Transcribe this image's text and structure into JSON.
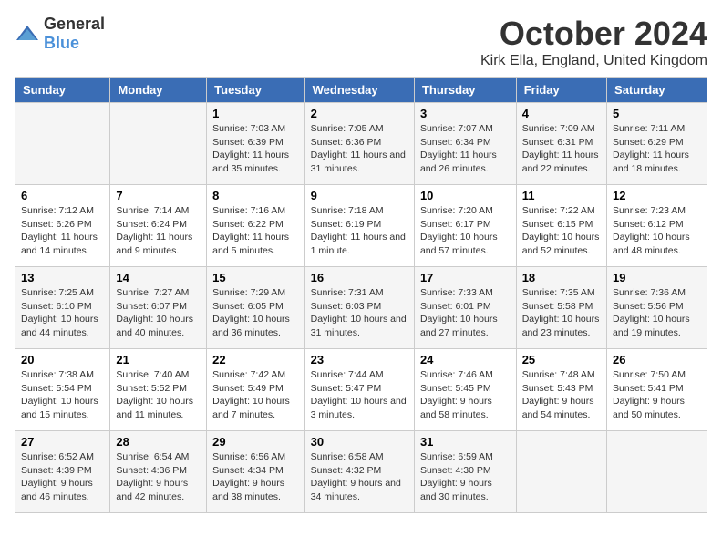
{
  "logo": {
    "general": "General",
    "blue": "Blue"
  },
  "title": "October 2024",
  "location": "Kirk Ella, England, United Kingdom",
  "days_header": [
    "Sunday",
    "Monday",
    "Tuesday",
    "Wednesday",
    "Thursday",
    "Friday",
    "Saturday"
  ],
  "weeks": [
    [
      {
        "day": "",
        "sunrise": "",
        "sunset": "",
        "daylight": ""
      },
      {
        "day": "",
        "sunrise": "",
        "sunset": "",
        "daylight": ""
      },
      {
        "day": "1",
        "sunrise": "Sunrise: 7:03 AM",
        "sunset": "Sunset: 6:39 PM",
        "daylight": "Daylight: 11 hours and 35 minutes."
      },
      {
        "day": "2",
        "sunrise": "Sunrise: 7:05 AM",
        "sunset": "Sunset: 6:36 PM",
        "daylight": "Daylight: 11 hours and 31 minutes."
      },
      {
        "day": "3",
        "sunrise": "Sunrise: 7:07 AM",
        "sunset": "Sunset: 6:34 PM",
        "daylight": "Daylight: 11 hours and 26 minutes."
      },
      {
        "day": "4",
        "sunrise": "Sunrise: 7:09 AM",
        "sunset": "Sunset: 6:31 PM",
        "daylight": "Daylight: 11 hours and 22 minutes."
      },
      {
        "day": "5",
        "sunrise": "Sunrise: 7:11 AM",
        "sunset": "Sunset: 6:29 PM",
        "daylight": "Daylight: 11 hours and 18 minutes."
      }
    ],
    [
      {
        "day": "6",
        "sunrise": "Sunrise: 7:12 AM",
        "sunset": "Sunset: 6:26 PM",
        "daylight": "Daylight: 11 hours and 14 minutes."
      },
      {
        "day": "7",
        "sunrise": "Sunrise: 7:14 AM",
        "sunset": "Sunset: 6:24 PM",
        "daylight": "Daylight: 11 hours and 9 minutes."
      },
      {
        "day": "8",
        "sunrise": "Sunrise: 7:16 AM",
        "sunset": "Sunset: 6:22 PM",
        "daylight": "Daylight: 11 hours and 5 minutes."
      },
      {
        "day": "9",
        "sunrise": "Sunrise: 7:18 AM",
        "sunset": "Sunset: 6:19 PM",
        "daylight": "Daylight: 11 hours and 1 minute."
      },
      {
        "day": "10",
        "sunrise": "Sunrise: 7:20 AM",
        "sunset": "Sunset: 6:17 PM",
        "daylight": "Daylight: 10 hours and 57 minutes."
      },
      {
        "day": "11",
        "sunrise": "Sunrise: 7:22 AM",
        "sunset": "Sunset: 6:15 PM",
        "daylight": "Daylight: 10 hours and 52 minutes."
      },
      {
        "day": "12",
        "sunrise": "Sunrise: 7:23 AM",
        "sunset": "Sunset: 6:12 PM",
        "daylight": "Daylight: 10 hours and 48 minutes."
      }
    ],
    [
      {
        "day": "13",
        "sunrise": "Sunrise: 7:25 AM",
        "sunset": "Sunset: 6:10 PM",
        "daylight": "Daylight: 10 hours and 44 minutes."
      },
      {
        "day": "14",
        "sunrise": "Sunrise: 7:27 AM",
        "sunset": "Sunset: 6:07 PM",
        "daylight": "Daylight: 10 hours and 40 minutes."
      },
      {
        "day": "15",
        "sunrise": "Sunrise: 7:29 AM",
        "sunset": "Sunset: 6:05 PM",
        "daylight": "Daylight: 10 hours and 36 minutes."
      },
      {
        "day": "16",
        "sunrise": "Sunrise: 7:31 AM",
        "sunset": "Sunset: 6:03 PM",
        "daylight": "Daylight: 10 hours and 31 minutes."
      },
      {
        "day": "17",
        "sunrise": "Sunrise: 7:33 AM",
        "sunset": "Sunset: 6:01 PM",
        "daylight": "Daylight: 10 hours and 27 minutes."
      },
      {
        "day": "18",
        "sunrise": "Sunrise: 7:35 AM",
        "sunset": "Sunset: 5:58 PM",
        "daylight": "Daylight: 10 hours and 23 minutes."
      },
      {
        "day": "19",
        "sunrise": "Sunrise: 7:36 AM",
        "sunset": "Sunset: 5:56 PM",
        "daylight": "Daylight: 10 hours and 19 minutes."
      }
    ],
    [
      {
        "day": "20",
        "sunrise": "Sunrise: 7:38 AM",
        "sunset": "Sunset: 5:54 PM",
        "daylight": "Daylight: 10 hours and 15 minutes."
      },
      {
        "day": "21",
        "sunrise": "Sunrise: 7:40 AM",
        "sunset": "Sunset: 5:52 PM",
        "daylight": "Daylight: 10 hours and 11 minutes."
      },
      {
        "day": "22",
        "sunrise": "Sunrise: 7:42 AM",
        "sunset": "Sunset: 5:49 PM",
        "daylight": "Daylight: 10 hours and 7 minutes."
      },
      {
        "day": "23",
        "sunrise": "Sunrise: 7:44 AM",
        "sunset": "Sunset: 5:47 PM",
        "daylight": "Daylight: 10 hours and 3 minutes."
      },
      {
        "day": "24",
        "sunrise": "Sunrise: 7:46 AM",
        "sunset": "Sunset: 5:45 PM",
        "daylight": "Daylight: 9 hours and 58 minutes."
      },
      {
        "day": "25",
        "sunrise": "Sunrise: 7:48 AM",
        "sunset": "Sunset: 5:43 PM",
        "daylight": "Daylight: 9 hours and 54 minutes."
      },
      {
        "day": "26",
        "sunrise": "Sunrise: 7:50 AM",
        "sunset": "Sunset: 5:41 PM",
        "daylight": "Daylight: 9 hours and 50 minutes."
      }
    ],
    [
      {
        "day": "27",
        "sunrise": "Sunrise: 6:52 AM",
        "sunset": "Sunset: 4:39 PM",
        "daylight": "Daylight: 9 hours and 46 minutes."
      },
      {
        "day": "28",
        "sunrise": "Sunrise: 6:54 AM",
        "sunset": "Sunset: 4:36 PM",
        "daylight": "Daylight: 9 hours and 42 minutes."
      },
      {
        "day": "29",
        "sunrise": "Sunrise: 6:56 AM",
        "sunset": "Sunset: 4:34 PM",
        "daylight": "Daylight: 9 hours and 38 minutes."
      },
      {
        "day": "30",
        "sunrise": "Sunrise: 6:58 AM",
        "sunset": "Sunset: 4:32 PM",
        "daylight": "Daylight: 9 hours and 34 minutes."
      },
      {
        "day": "31",
        "sunrise": "Sunrise: 6:59 AM",
        "sunset": "Sunset: 4:30 PM",
        "daylight": "Daylight: 9 hours and 30 minutes."
      },
      {
        "day": "",
        "sunrise": "",
        "sunset": "",
        "daylight": ""
      },
      {
        "day": "",
        "sunrise": "",
        "sunset": "",
        "daylight": ""
      }
    ]
  ]
}
